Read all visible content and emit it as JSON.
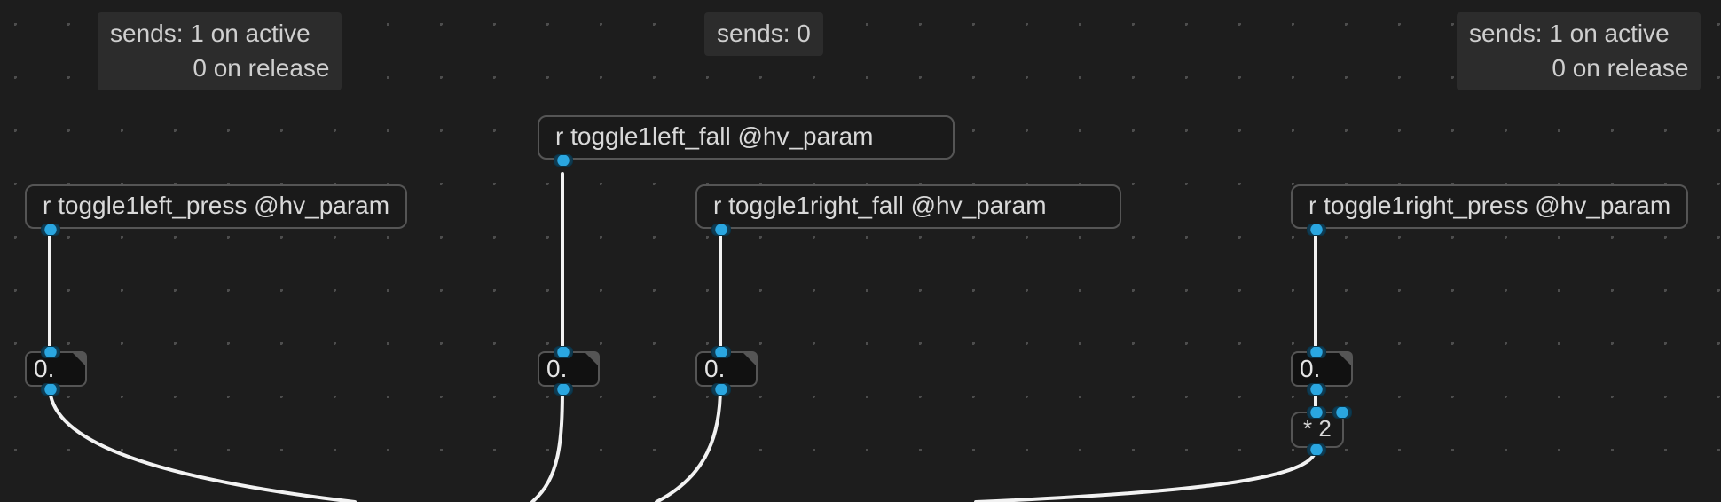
{
  "comments": {
    "left_press": "sends: 1 on active\n            0 on release",
    "center_fall": "sends: 0",
    "right_press": "sends: 1 on active\n            0 on release"
  },
  "objects": {
    "left_press": "r toggle1left_press @hv_param",
    "left_fall": "r toggle1left_fall @hv_param",
    "right_fall": "r toggle1right_fall @hv_param",
    "right_press": "r toggle1right_press @hv_param",
    "multiply": "* 2"
  },
  "numbers": {
    "left_press": "0.",
    "left_fall": "0.",
    "right_fall": "0.",
    "right_press": "0."
  }
}
